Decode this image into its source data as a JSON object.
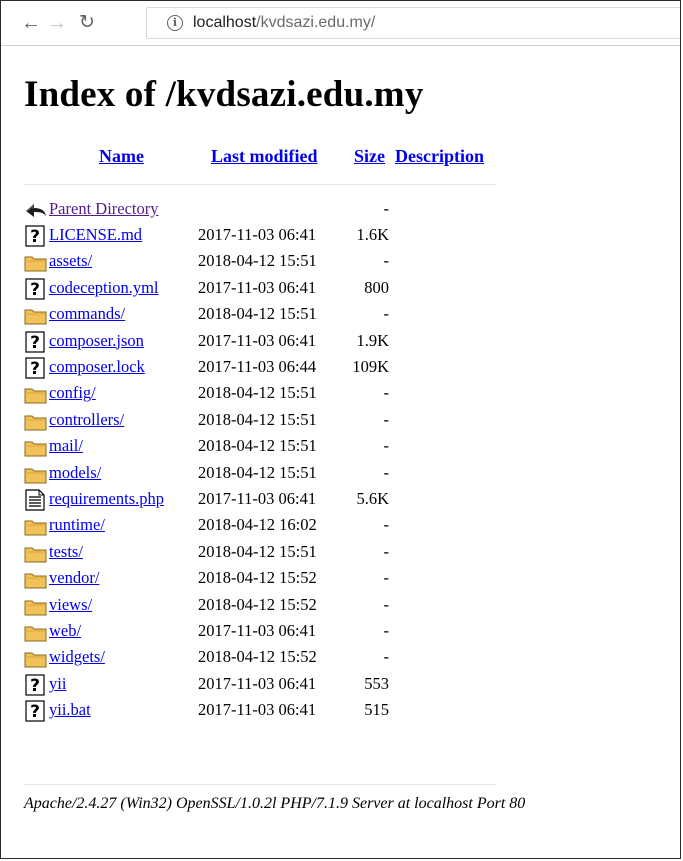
{
  "browser": {
    "url_host": "localhost",
    "url_path": "/kvdsazi.edu.my/"
  },
  "page": {
    "heading": "Index of /kvdsazi.edu.my",
    "columns": {
      "name": "Name",
      "last_modified": "Last modified",
      "size": "Size",
      "description": "Description"
    },
    "parent_label": "Parent Directory",
    "parent_size": "-",
    "entries": [
      {
        "name": "LICENSE.md",
        "date": "2017-11-03 06:41",
        "size": "1.6K",
        "icon": "unknown-file-icon"
      },
      {
        "name": "assets/",
        "date": "2018-04-12 15:51",
        "size": "-",
        "icon": "folder-icon"
      },
      {
        "name": "codeception.yml",
        "date": "2017-11-03 06:41",
        "size": "800",
        "icon": "unknown-file-icon"
      },
      {
        "name": "commands/",
        "date": "2018-04-12 15:51",
        "size": "-",
        "icon": "folder-icon"
      },
      {
        "name": "composer.json",
        "date": "2017-11-03 06:41",
        "size": "1.9K",
        "icon": "unknown-file-icon"
      },
      {
        "name": "composer.lock",
        "date": "2017-11-03 06:44",
        "size": "109K",
        "icon": "unknown-file-icon"
      },
      {
        "name": "config/",
        "date": "2018-04-12 15:51",
        "size": "-",
        "icon": "folder-icon"
      },
      {
        "name": "controllers/",
        "date": "2018-04-12 15:51",
        "size": "-",
        "icon": "folder-icon"
      },
      {
        "name": "mail/",
        "date": "2018-04-12 15:51",
        "size": "-",
        "icon": "folder-icon"
      },
      {
        "name": "models/",
        "date": "2018-04-12 15:51",
        "size": "-",
        "icon": "folder-icon"
      },
      {
        "name": "requirements.php",
        "date": "2017-11-03 06:41",
        "size": "5.6K",
        "icon": "text-file-icon"
      },
      {
        "name": "runtime/",
        "date": "2018-04-12 16:02",
        "size": "-",
        "icon": "folder-icon"
      },
      {
        "name": "tests/",
        "date": "2018-04-12 15:51",
        "size": "-",
        "icon": "folder-icon"
      },
      {
        "name": "vendor/",
        "date": "2018-04-12 15:52",
        "size": "-",
        "icon": "folder-icon"
      },
      {
        "name": "views/",
        "date": "2018-04-12 15:52",
        "size": "-",
        "icon": "folder-icon"
      },
      {
        "name": "web/",
        "date": "2017-11-03 06:41",
        "size": "-",
        "icon": "folder-icon"
      },
      {
        "name": "widgets/",
        "date": "2018-04-12 15:52",
        "size": "-",
        "icon": "folder-icon"
      },
      {
        "name": "yii",
        "date": "2017-11-03 06:41",
        "size": "553",
        "icon": "unknown-file-icon"
      },
      {
        "name": "yii.bat",
        "date": "2017-11-03 06:41",
        "size": "515",
        "icon": "unknown-file-icon"
      }
    ],
    "footer": "Apache/2.4.27 (Win32) OpenSSL/1.0.2l PHP/7.1.9 Server at localhost Port 80"
  },
  "colors": {
    "link": "#0000ee",
    "visited_link": "#551a8b",
    "folder": "#f2c25a"
  }
}
